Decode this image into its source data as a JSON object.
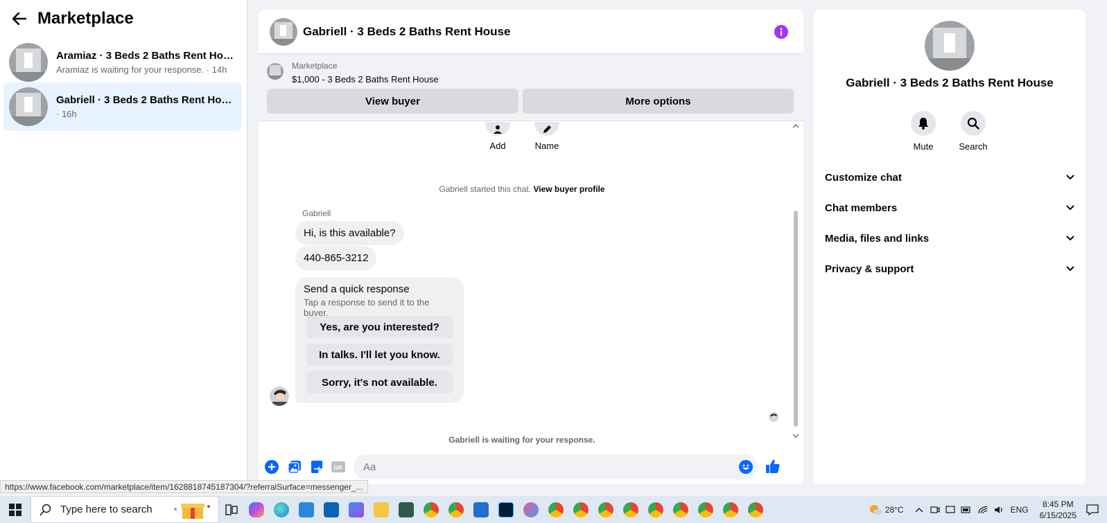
{
  "sidebar": {
    "title": "Marketplace",
    "conversations": [
      {
        "title": "Aramiaz · 3 Beds 2 Baths Rent Hou...",
        "subtitle": "Aramiaz is waiting for your response. · 14h"
      },
      {
        "title": "Gabriell · 3 Beds 2 Baths Rent House",
        "subtitle": "· 16h"
      }
    ]
  },
  "chat": {
    "title": "Gabriell · 3 Beds 2 Baths Rent House",
    "listing_label": "Marketplace",
    "listing_price": "$1,000 - 3 Beds 2 Baths Rent House",
    "view_buyer": "View buyer",
    "more_options": "More options",
    "add_label": "Add",
    "name_label": "Name",
    "started_text": "Gabriell started this chat.",
    "view_profile": "View buyer profile",
    "sender": "Gabriell",
    "messages": [
      "Hi, is this available?",
      "440-865-3212"
    ],
    "quick": {
      "title": "Send a quick response",
      "subtitle": "Tap a response to send it to the buyer.",
      "options": [
        "Yes, are you interested?",
        "In talks. I'll let you know.",
        "Sorry, it's not available."
      ]
    },
    "waiting": "Gabriell is waiting for your response.",
    "composer_placeholder": "Aa",
    "gif_label": "GIF"
  },
  "right_panel": {
    "title": "Gabriell · 3 Beds 2 Baths Rent House",
    "mute": "Mute",
    "search": "Search",
    "sections": [
      "Customize chat",
      "Chat members",
      "Media, files and links",
      "Privacy & support"
    ]
  },
  "status_url": "https://www.facebook.com/marketplace/item/1628818745187304/?referralSurface=messenger_...",
  "taskbar": {
    "search_placeholder": "Type here to search",
    "temperature": "28°C",
    "language": "ENG",
    "time": "8:45 PM",
    "date": "6/15/2025"
  },
  "colors": {
    "accent": "#0866ff",
    "info": "#a033ff",
    "active_row": "#e7f3ff"
  }
}
